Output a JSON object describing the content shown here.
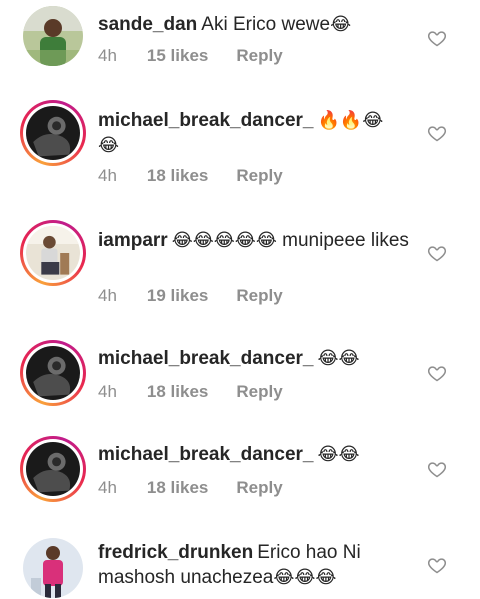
{
  "comments": [
    {
      "username": "sande_dan",
      "text": "Aki Erico wewe",
      "emoji": "😂",
      "time": "4h",
      "likes": "15 likes",
      "reply": "Reply",
      "avatar": "photo-man-green-outdoor"
    },
    {
      "username": "michael_break_dancer_",
      "text": "",
      "emoji": "🔥🔥😂",
      "emoji2": "😂",
      "time": "4h",
      "likes": "18 likes",
      "reply": "Reply",
      "avatar": "photo-bw-dancer"
    },
    {
      "username": "iamparr",
      "emoji": "😂😂😂😂😂",
      "text": "munipeee likes",
      "time": "4h",
      "likes": "19 likes",
      "reply": "Reply",
      "avatar": "photo-person-sitting"
    },
    {
      "username": "michael_break_dancer_",
      "emoji": "😂😂",
      "time": "4h",
      "likes": "18 likes",
      "reply": "Reply",
      "avatar": "photo-bw-dancer"
    },
    {
      "username": "michael_break_dancer_",
      "emoji": "😂😂",
      "time": "4h",
      "likes": "18 likes",
      "reply": "Reply",
      "avatar": "photo-bw-dancer"
    },
    {
      "username": "fredrick_drunken",
      "text": "Erico hao Ni mashosh unachezea",
      "emoji": "😂😂😂",
      "avatar": "photo-man-pink-shirt"
    }
  ],
  "icons": {
    "like": "heart-outline-icon"
  },
  "colors": {
    "text": "#262626",
    "meta": "#8e8e8e",
    "story_ring_start": "#f9a13a",
    "story_ring_end": "#c01c8c"
  }
}
